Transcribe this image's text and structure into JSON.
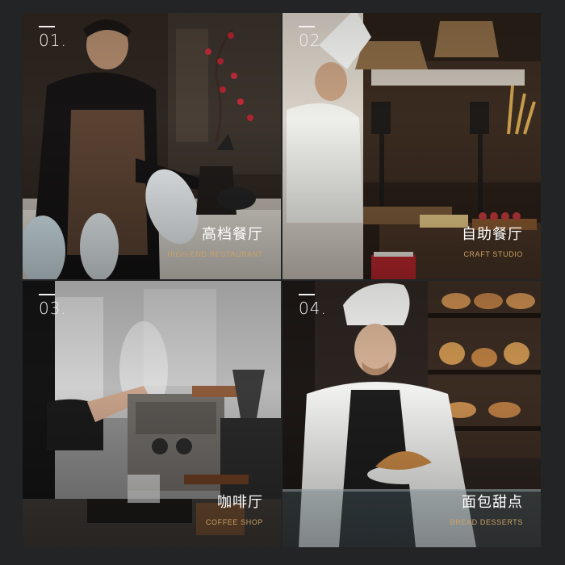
{
  "tiles": [
    {
      "number": "01.",
      "title_cn": "高档餐厅",
      "title_en": "HIGH-END RESTAURANT"
    },
    {
      "number": "02.",
      "title_cn": "自助餐厅",
      "title_en": "CRAFT STUDIO"
    },
    {
      "number": "03.",
      "title_cn": "咖啡厅",
      "title_en": "COFFEE SHOP"
    },
    {
      "number": "04.",
      "title_cn": "面包甜点",
      "title_en": "BREAD DESSERTS"
    }
  ],
  "colors": {
    "background": "#232425",
    "accent_en_text": "#c9a265",
    "title_text": "#ffffff"
  }
}
